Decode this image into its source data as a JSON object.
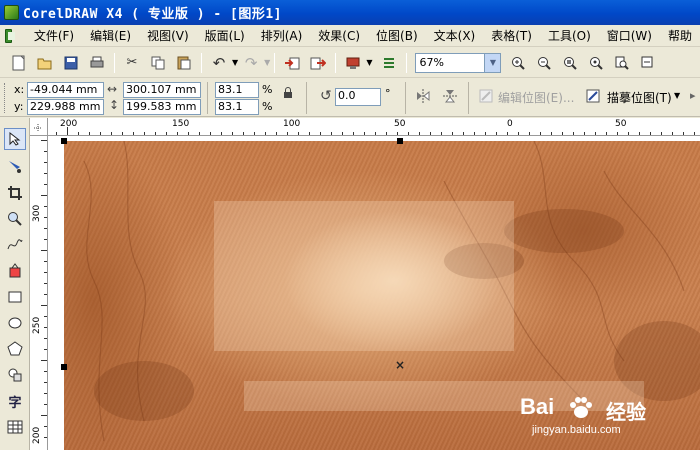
{
  "window": {
    "title": "CorelDRAW X4 ( 专业版 ) - [图形1]"
  },
  "menu": {
    "items": [
      "文件(F)",
      "编辑(E)",
      "视图(V)",
      "版面(L)",
      "排列(A)",
      "效果(C)",
      "位图(B)",
      "文本(X)",
      "表格(T)",
      "工具(O)",
      "窗口(W)",
      "帮助"
    ]
  },
  "toolbar": {
    "zoom_value": "67%"
  },
  "propbar": {
    "x_label": "x:",
    "y_label": "y:",
    "x_value": "-49.044 mm",
    "y_value": "229.988 mm",
    "width_value": "300.107 mm",
    "height_value": "199.583 mm",
    "scale_x": "83.1",
    "scale_y": "83.1",
    "percent": "%",
    "rotation": "0.0",
    "degree": "°",
    "edit_bitmap": "编辑位图(E)...",
    "trace_bitmap": "描摹位图(T)"
  },
  "ruler": {
    "h_labels": [
      "200",
      "150",
      "100",
      "50",
      "0",
      "50"
    ],
    "v_labels": [
      "300",
      "250",
      "200"
    ]
  },
  "watermark": {
    "brand": "Bai",
    "brand_cn": "经验",
    "url": "jingyan.baidu.com"
  },
  "colors": {
    "title_blue": "#0a5fd8",
    "bitmap_base": "#c77a47"
  }
}
